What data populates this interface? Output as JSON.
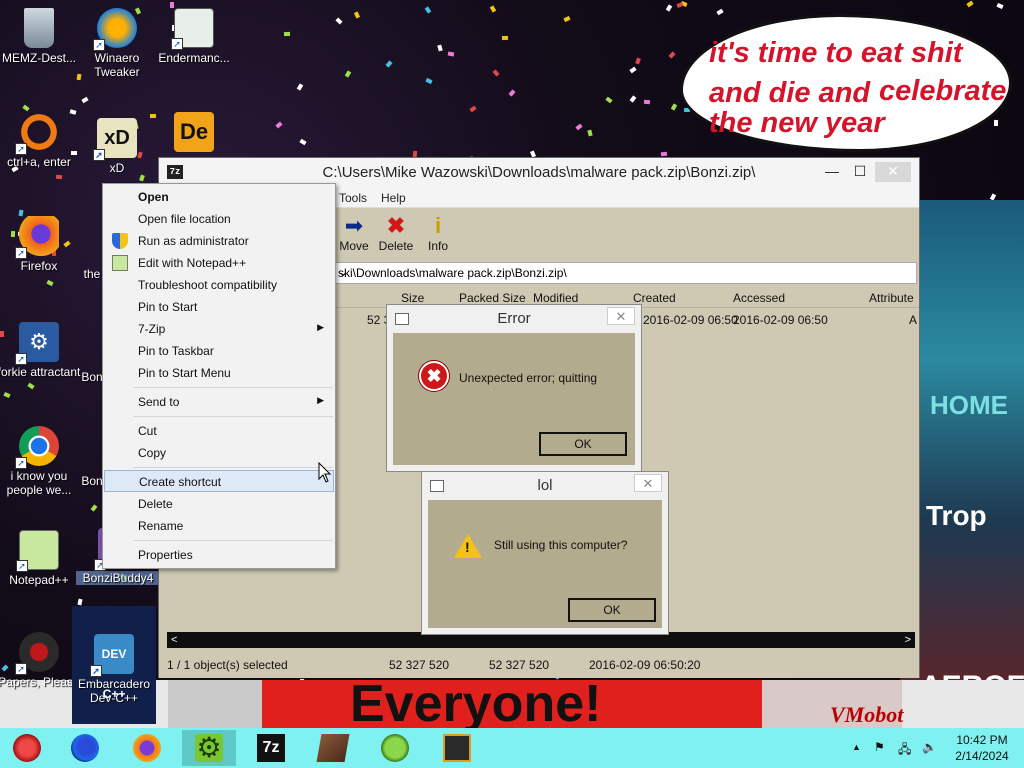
{
  "desktop": {
    "icons": [
      {
        "label": "MEMZ-Dest...",
        "icon": "recycle-bin-icon"
      },
      {
        "label": "Winaero Tweaker",
        "icon": "winaero-icon"
      },
      {
        "label": "Endermanc...",
        "icon": "document-window-icon"
      },
      {
        "label": "ctrl+a, enter",
        "icon": "orange-ring-icon"
      },
      {
        "label": "xD",
        "icon": "xd-icon"
      },
      {
        "label": "Firefox",
        "icon": "firefox-icon"
      },
      {
        "label": "the",
        "icon": "app-icon"
      },
      {
        "label": "forkie attractant",
        "icon": "gear-computer-icon"
      },
      {
        "label": "Bon",
        "icon": "bonzi-icon"
      },
      {
        "label": "i know you people we...",
        "icon": "chrome-icon"
      },
      {
        "label": "Bon",
        "icon": "bonzi-icon"
      },
      {
        "label": "Notepad++",
        "icon": "notepadpp-icon"
      },
      {
        "label": "BonziBuddy4",
        "icon": "bonzibuddy-icon"
      },
      {
        "label": "Papers, Please",
        "icon": "papers-please-icon"
      },
      {
        "label": "Embarcadero Dev-C++",
        "icon": "devcpp-icon"
      }
    ]
  },
  "bubble": {
    "line1": "it's time to eat shit",
    "line2": "and die and",
    "line2b": "celebrate",
    "line3": "the new year"
  },
  "background": {
    "banner": "Everyone!",
    "home": "HOME",
    "sign1": "Trop",
    "sign2": "AEROFOS",
    "watermark": "VMobot"
  },
  "window": {
    "title": "C:\\Users\\Mike Wazowski\\Downloads\\malware pack.zip\\Bonzi.zip\\",
    "app_icon": "7z",
    "menu": [
      "Tools",
      "Help"
    ],
    "toolbar": [
      {
        "label": "Move",
        "icon": "move-arrow-icon"
      },
      {
        "label": "Delete",
        "icon": "delete-x-icon"
      },
      {
        "label": "Info",
        "icon": "info-icon"
      }
    ],
    "address": "ski\\Downloads\\malware pack.zip\\Bonzi.zip\\",
    "columns": [
      "Size",
      "Packed Size",
      "Modified",
      "Created",
      "Accessed",
      "Attribute"
    ],
    "row": {
      "size": "52 3",
      "created": "2016-02-09 06:50",
      "accessed": "2016-02-09 06:50",
      "attr": "A"
    },
    "status": {
      "selected": "1 / 1 object(s) selected",
      "size": "52 327 520",
      "packed": "52 327 520",
      "date": "2016-02-09 06:50:20"
    },
    "controls": {
      "minimize": "—",
      "maximize": "☐",
      "close": "✕"
    }
  },
  "error_dialog": {
    "title": "Error",
    "message": "Unexpected error; quitting",
    "ok": "OK",
    "close": "✕",
    "icon": "error-icon"
  },
  "lol_dialog": {
    "title": "lol",
    "message": "Still using this computer?",
    "ok": "OK",
    "close": "✕",
    "icon": "warning-icon"
  },
  "context_menu": {
    "items": [
      {
        "label": "Open",
        "bold": true
      },
      {
        "label": "Open file location"
      },
      {
        "label": "Run as administrator",
        "icon": "shield-icon"
      },
      {
        "label": "Edit with Notepad++",
        "icon": "notepadpp-icon"
      },
      {
        "label": "Troubleshoot compatibility"
      },
      {
        "label": "Pin to Start"
      },
      {
        "label": "7-Zip",
        "submenu": true
      },
      {
        "label": "Pin to Taskbar"
      },
      {
        "label": "Pin to Start Menu"
      },
      {
        "label": "Send to",
        "submenu": true
      },
      {
        "label": "Cut"
      },
      {
        "label": "Copy"
      },
      {
        "label": "Create shortcut",
        "selected": true
      },
      {
        "label": "Delete"
      },
      {
        "label": "Rename"
      },
      {
        "label": "Properties"
      }
    ]
  },
  "taskbar": {
    "items": [
      {
        "icon": "start-orb-icon"
      },
      {
        "icon": "firefox-icon"
      },
      {
        "icon": "firefox-alt-icon"
      },
      {
        "icon": "gear-icon",
        "active": true
      },
      {
        "icon": "7zip-icon"
      },
      {
        "icon": "book-icon"
      },
      {
        "icon": "frog-icon"
      },
      {
        "icon": "terminal-icon"
      }
    ],
    "tray_chevron": "▲",
    "clock_time": "10:42 PM",
    "clock_date": "2/14/2024"
  },
  "colors": {
    "taskbar": "#7ff1f0",
    "dialog_body": "#b3ab8d",
    "bubble_text": "#d4142a",
    "window_body": "#cfc9b4"
  }
}
